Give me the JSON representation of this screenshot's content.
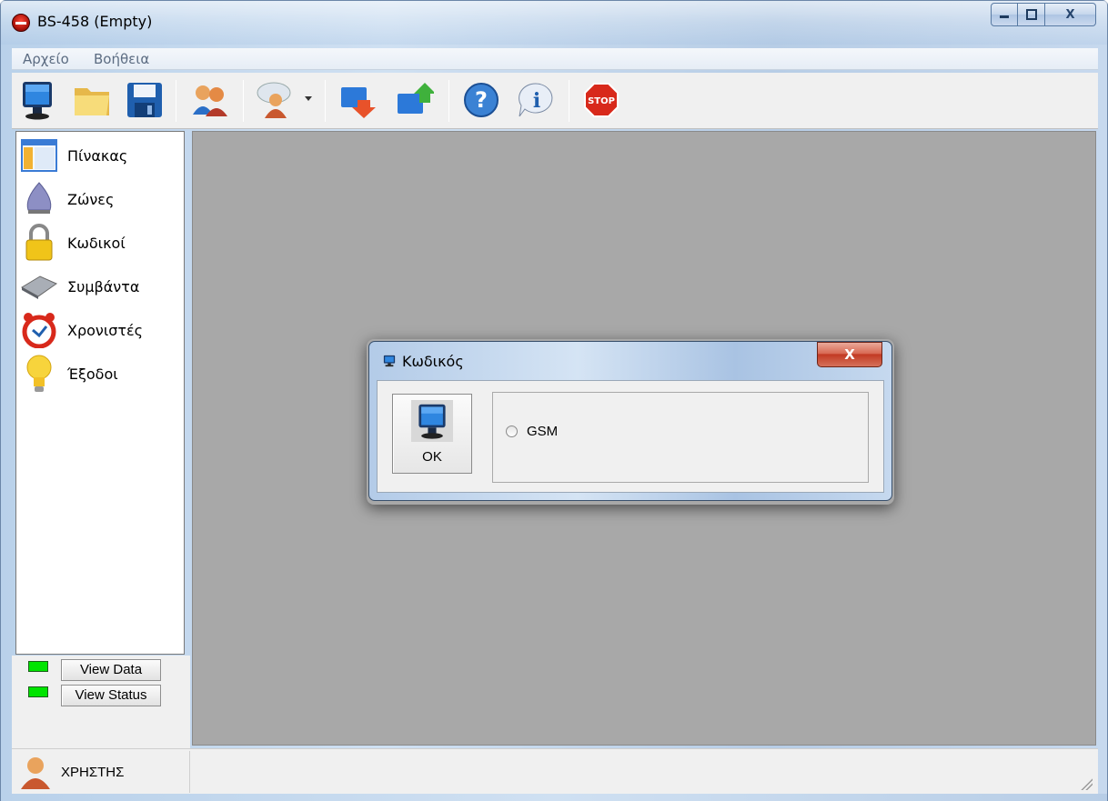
{
  "window": {
    "title": "BS-458 (Empty)",
    "controls": {
      "minimize_icon": "minimize-icon",
      "maximize_icon": "maximize-icon",
      "close_label": "X"
    }
  },
  "menu": {
    "items": [
      {
        "label": "Αρχείο"
      },
      {
        "label": "Βοήθεια"
      }
    ]
  },
  "toolbar": {
    "buttons": [
      {
        "icon": "monitor-icon"
      },
      {
        "icon": "folder-icon"
      },
      {
        "icon": "save-icon"
      },
      {
        "icon": "users-icon"
      },
      {
        "icon": "user-chat-icon"
      },
      {
        "icon": "download-icon"
      },
      {
        "icon": "upload-icon"
      },
      {
        "icon": "help-icon"
      },
      {
        "icon": "info-icon"
      },
      {
        "icon": "stop-icon",
        "label": "STOP"
      }
    ]
  },
  "sidebar": {
    "items": [
      {
        "label": "Πίνακας",
        "icon": "panel-icon"
      },
      {
        "label": "Ζώνες",
        "icon": "zones-icon"
      },
      {
        "label": "Κωδικοί",
        "icon": "lock-icon"
      },
      {
        "label": "Συμβάντα",
        "icon": "events-icon"
      },
      {
        "label": "Χρονιστές",
        "icon": "alarm-clock-icon"
      },
      {
        "label": "Έξοδοι",
        "icon": "lightbulb-icon"
      }
    ]
  },
  "view_buttons": {
    "view_data": "View Data",
    "view_status": "View Status",
    "led_color": "#00e400"
  },
  "status": {
    "user_label": "ΧΡΗΣΤΗΣ"
  },
  "dialog": {
    "title": "Κωδικός",
    "close_label": "X",
    "ok_label": "OK",
    "radio_label": "GSM",
    "radio_selected": false
  },
  "colors": {
    "workspace": "#a8a8a8",
    "dialog_close": "#c23a23",
    "led": "#00e400"
  }
}
